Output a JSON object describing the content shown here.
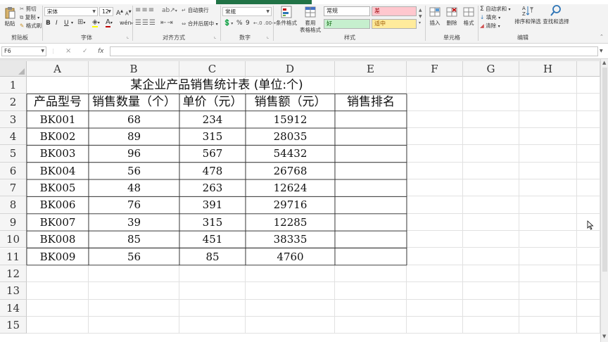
{
  "ribbon": {
    "clipboard": {
      "paste": "粘贴",
      "cut": "剪切",
      "copy": "复制",
      "format_painter": "格式刷",
      "label": "剪贴板"
    },
    "font": {
      "name": "宋体",
      "size": "12",
      "grow": "A",
      "shrink": "A",
      "bold": "B",
      "italic": "I",
      "underline": "U",
      "wen": "wén",
      "label": "字体"
    },
    "alignment": {
      "wrap_text": "自动换行",
      "merge_center": "合并后居中",
      "label": "对齐方式"
    },
    "number": {
      "format": "常规",
      "percent": "%",
      "comma": "9",
      "label": "数字"
    },
    "styles": {
      "conditional": "条件格式",
      "table_format_line1": "套用",
      "table_format_line2": "表格格式",
      "normal": "常规",
      "bad": "差",
      "good": "好",
      "neutral": "适中",
      "label": "样式"
    },
    "cells": {
      "insert": "插入",
      "delete": "删除",
      "format": "格式",
      "label": "单元格"
    },
    "editing": {
      "autosum": "自动求和",
      "fill": "填充",
      "clear": "清除",
      "sort_filter": "排序和筛选",
      "find_select": "查找和选择",
      "label": "编辑"
    },
    "colors": {
      "accent": "#217346",
      "bad_bg": "#ffc7ce",
      "bad_text": "#9c0006",
      "good_bg": "#c6efce",
      "good_text": "#006100",
      "neutral_bg": "#ffeb9c",
      "neutral_text": "#9c5700",
      "font_color": "#c00000",
      "fill_color": "#ffff00"
    }
  },
  "formula_bar": {
    "name_box": "F6",
    "cancel": "×",
    "enter": "✓",
    "fx": "fx",
    "value": ""
  },
  "sheet": {
    "columns": [
      "A",
      "B",
      "C",
      "D",
      "E",
      "F",
      "G",
      "H"
    ],
    "rows": [
      "1",
      "2",
      "3",
      "4",
      "5",
      "6",
      "7",
      "8",
      "9",
      "10",
      "11",
      "12",
      "13",
      "14",
      "15"
    ],
    "title": "某企业产品销售统计表 (单位:个)",
    "headers": [
      "产品型号",
      "销售数量（个）",
      "单价（元）",
      "销售额（元）",
      "销售排名"
    ],
    "data": [
      [
        "BK001",
        "68",
        "234",
        "15912",
        ""
      ],
      [
        "BK002",
        "89",
        "315",
        "28035",
        ""
      ],
      [
        "BK003",
        "96",
        "567",
        "54432",
        ""
      ],
      [
        "BK004",
        "56",
        "478",
        "26768",
        ""
      ],
      [
        "BK005",
        "48",
        "263",
        "12624",
        ""
      ],
      [
        "BK006",
        "76",
        "391",
        "29716",
        ""
      ],
      [
        "BK007",
        "39",
        "315",
        "12285",
        ""
      ],
      [
        "BK008",
        "85",
        "451",
        "38335",
        ""
      ],
      [
        "BK009",
        "56",
        "85",
        "4760",
        ""
      ]
    ]
  }
}
